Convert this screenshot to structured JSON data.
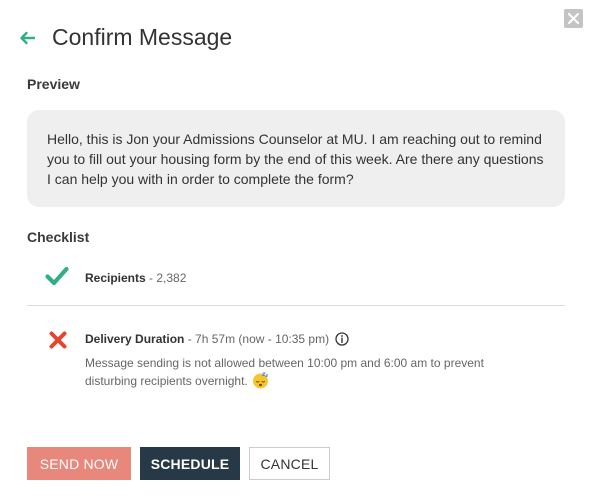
{
  "header": {
    "title": "Confirm Message"
  },
  "preview": {
    "label": "Preview",
    "message": "Hello, this is Jon your Admissions Counselor at MU. I am reaching out to remind you to fill out your housing form by the end of this week. Are there any questions I can help you with in order to complete the form?"
  },
  "checklist": {
    "label": "Checklist",
    "items": [
      {
        "name": "Recipients",
        "detail": " - 2,382",
        "status": "pass",
        "icon": "check-icon"
      },
      {
        "name": "Delivery Duration",
        "detail": " - 7h 57m (now - 10:35 pm)",
        "status": "fail",
        "icon": "x-icon",
        "warning": "Message sending is not allowed between 10:00 pm and 6:00 am to prevent disturbing recipients overnight."
      }
    ]
  },
  "buttons": {
    "send_now": "SEND NOW",
    "schedule": "SCHEDULE",
    "cancel": "CANCEL"
  },
  "colors": {
    "accent_green": "#2eb082",
    "error_red": "#e8432e",
    "send_now_bg": "#e8877c",
    "schedule_bg": "#273947"
  }
}
